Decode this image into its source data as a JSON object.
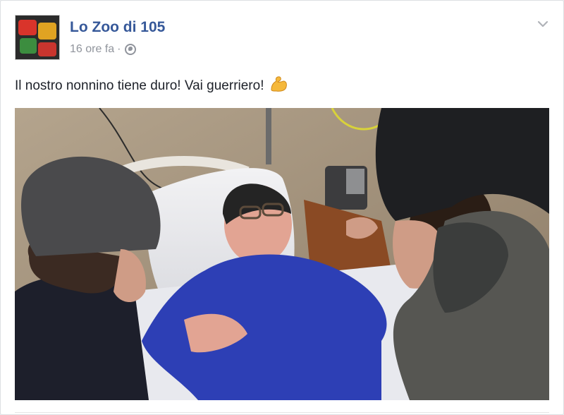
{
  "post": {
    "page_name": "Lo Zoo di 105",
    "timestamp": "16 ore fa",
    "separator": "·",
    "privacy_icon": "globe-icon",
    "options_icon": "chevron-down-icon",
    "text": "Il nostro nonnino tiene duro! Vai guerriero!",
    "emoji": "flexed-biceps-icon"
  },
  "avatar": {
    "icon": "page-logo"
  },
  "colors": {
    "link": "#365899",
    "meta": "#90949c",
    "text": "#1d2129"
  }
}
